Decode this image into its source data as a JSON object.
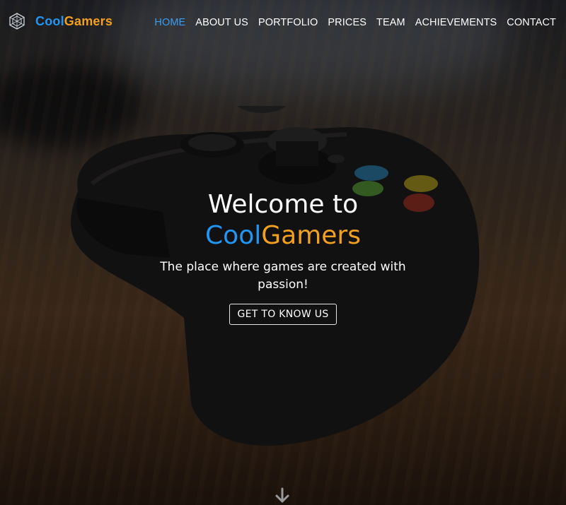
{
  "brand": {
    "cool": "Cool",
    "gamers": "Gamers",
    "logo_icon": "hexagon-logo-icon"
  },
  "nav": {
    "items": [
      {
        "label": "HOME",
        "active": true
      },
      {
        "label": "ABOUT US",
        "active": false
      },
      {
        "label": "PORTFOLIO",
        "active": false
      },
      {
        "label": "PRICES",
        "active": false
      },
      {
        "label": "TEAM",
        "active": false
      },
      {
        "label": "ACHIEVEMENTS",
        "active": false
      },
      {
        "label": "CONTACT",
        "active": false
      }
    ]
  },
  "hero": {
    "title_line1": "Welcome to",
    "title_cool": "Cool",
    "title_gamers": "Gamers",
    "subtitle": "The place where games are created with passion!",
    "cta_label": "GET TO KNOW US",
    "scroll_icon": "arrow-down-icon"
  },
  "colors": {
    "accent_blue": "#2196f3",
    "accent_orange": "#f2a01f",
    "nav_active": "#3a9df0"
  }
}
